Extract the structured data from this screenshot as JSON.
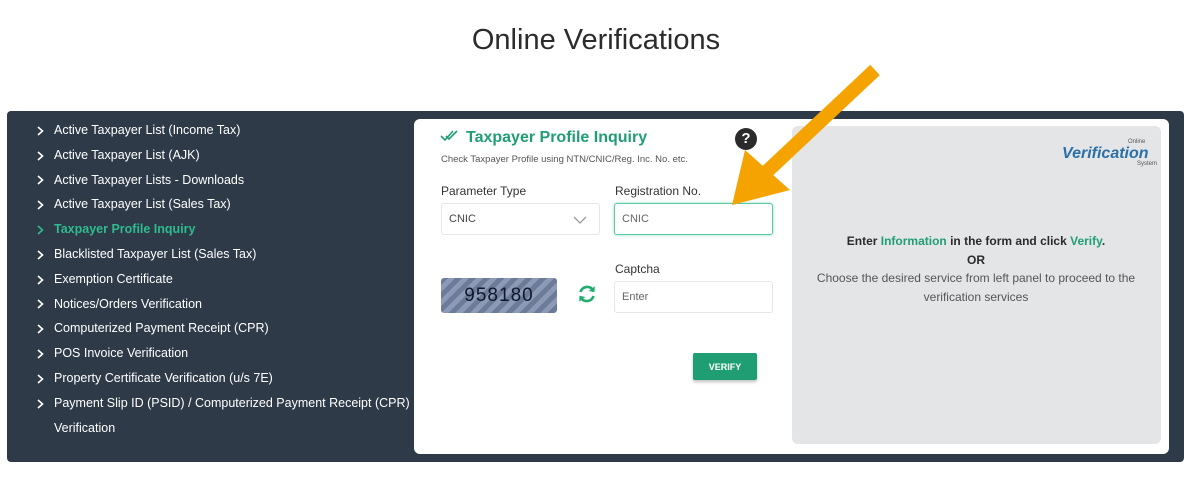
{
  "page": {
    "title": "Online Verifications"
  },
  "sidebar": {
    "items": [
      {
        "label": "Active Taxpayer List (Income Tax)",
        "active": false
      },
      {
        "label": "Active Taxpayer List (AJK)",
        "active": false
      },
      {
        "label": "Active Taxpayer Lists - Downloads",
        "active": false
      },
      {
        "label": "Active Taxpayer List (Sales Tax)",
        "active": false
      },
      {
        "label": "Taxpayer Profile Inquiry",
        "active": true
      },
      {
        "label": "Blacklisted Taxpayer List (Sales Tax)",
        "active": false
      },
      {
        "label": "Exemption Certificate",
        "active": false
      },
      {
        "label": "Notices/Orders Verification",
        "active": false
      },
      {
        "label": "Computerized Payment Receipt (CPR)",
        "active": false
      },
      {
        "label": "POS Invoice Verification",
        "active": false
      },
      {
        "label": "Property Certificate Verification (u/s 7E)",
        "active": false
      },
      {
        "label": "Payment Slip ID (PSID) / Computerized Payment Receipt (CPR)",
        "active": false
      },
      {
        "label": "Verification",
        "active": false
      }
    ]
  },
  "form": {
    "title": "Taxpayer Profile Inquiry",
    "subtitle": "Check Taxpayer Profile using NTN/CNIC/Reg. Inc. No. etc.",
    "help_glyph": "?",
    "parameter_type_label": "Parameter Type",
    "parameter_type_value": "CNIC",
    "registration_label": "Registration No.",
    "registration_placeholder": "CNIC",
    "captcha_label": "Captcha",
    "captcha_code": "958180",
    "captcha_placeholder": "Enter",
    "verify_label": "VERIFY"
  },
  "info": {
    "logo_small_top": "Online",
    "logo_main": "Verification",
    "logo_small_bottom": "System",
    "line1_prefix": "Enter ",
    "line1_highlight1": "Information",
    "line1_middle": " in the form and click ",
    "line1_highlight2": "Verify",
    "line1_suffix": ".",
    "line2": "OR",
    "line3": "Choose the desired service from left panel to proceed to the verification services"
  },
  "colors": {
    "accent_green": "#1f9e74",
    "sidebar_bg": "#2e3a48",
    "annotation_arrow": "#f5a300"
  },
  "icons": {
    "sidebar_chevron": "chevron-right-icon",
    "title_ticks": "double-check-icon",
    "help": "question-circle-icon",
    "select_caret": "chevron-down-icon",
    "refresh": "refresh-icon"
  }
}
